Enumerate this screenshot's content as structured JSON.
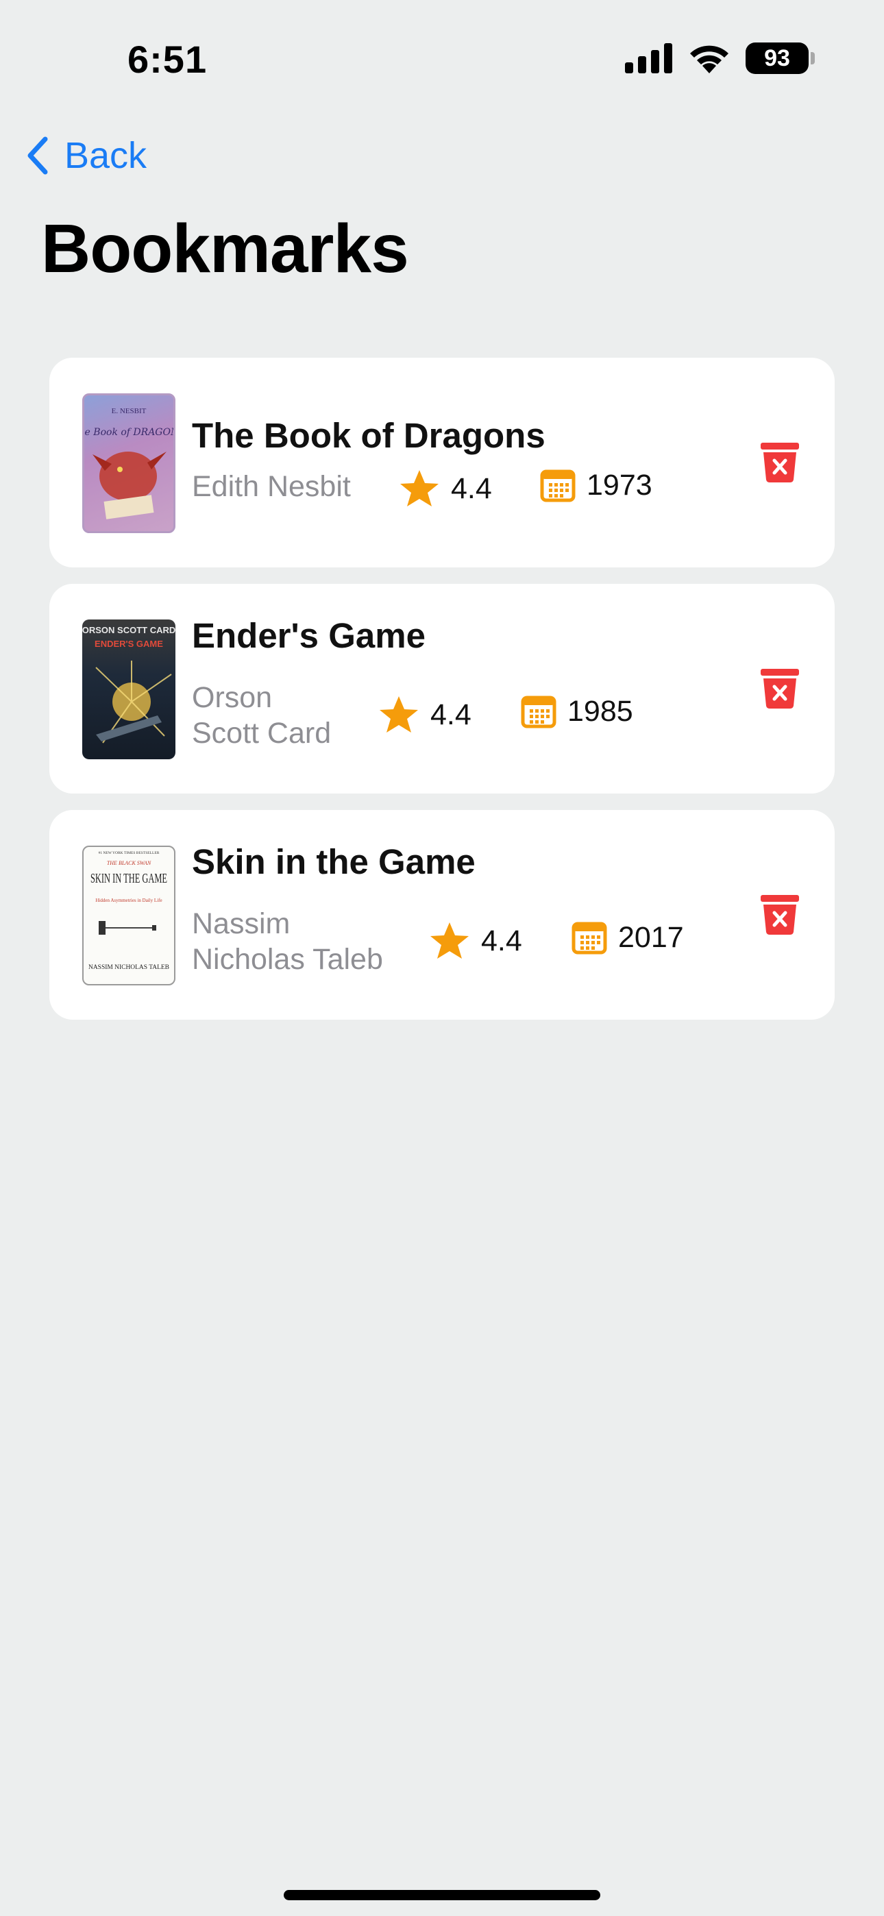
{
  "status_bar": {
    "time": "6:51",
    "battery": "93"
  },
  "nav": {
    "back_label": "Back"
  },
  "page": {
    "title": "Bookmarks"
  },
  "bookmarks": [
    {
      "title": "The Book of Dragons",
      "author": "Edith Nesbit",
      "rating": "4.4",
      "year": "1973",
      "cover": {
        "author_text": "E. NESBIT",
        "title_text": "The Book of DRAGONS"
      }
    },
    {
      "title": "Ender's Game",
      "author_lines": [
        "Orson",
        "Scott Card"
      ],
      "rating": "4.4",
      "year": "1985",
      "cover": {
        "author_text": "ORSON SCOTT CARD",
        "title_text": "ENDER'S GAME"
      }
    },
    {
      "title": "Skin in the Game",
      "author_lines": [
        "Nassim",
        "Nicholas Taleb"
      ],
      "rating": "4.4",
      "year": "2017",
      "cover": {
        "top_text": "#1 NEW YORK TIMES BESTSELLER",
        "series_text": "THE BLACK SWAN",
        "title_text": "SKIN IN THE GAME",
        "subtitle_text": "Hidden Asymmetries in Daily Life",
        "author_text": "NASSIM NICHOLAS TALEB"
      }
    }
  ],
  "colors": {
    "accent": "#1a7cf5",
    "star": "#f59c0b",
    "delete": "#f0393a",
    "background": "#eceeee"
  },
  "icons": {
    "back": "chevron-left-icon",
    "rating": "star-icon",
    "year": "calendar-icon",
    "delete": "trash-icon"
  }
}
